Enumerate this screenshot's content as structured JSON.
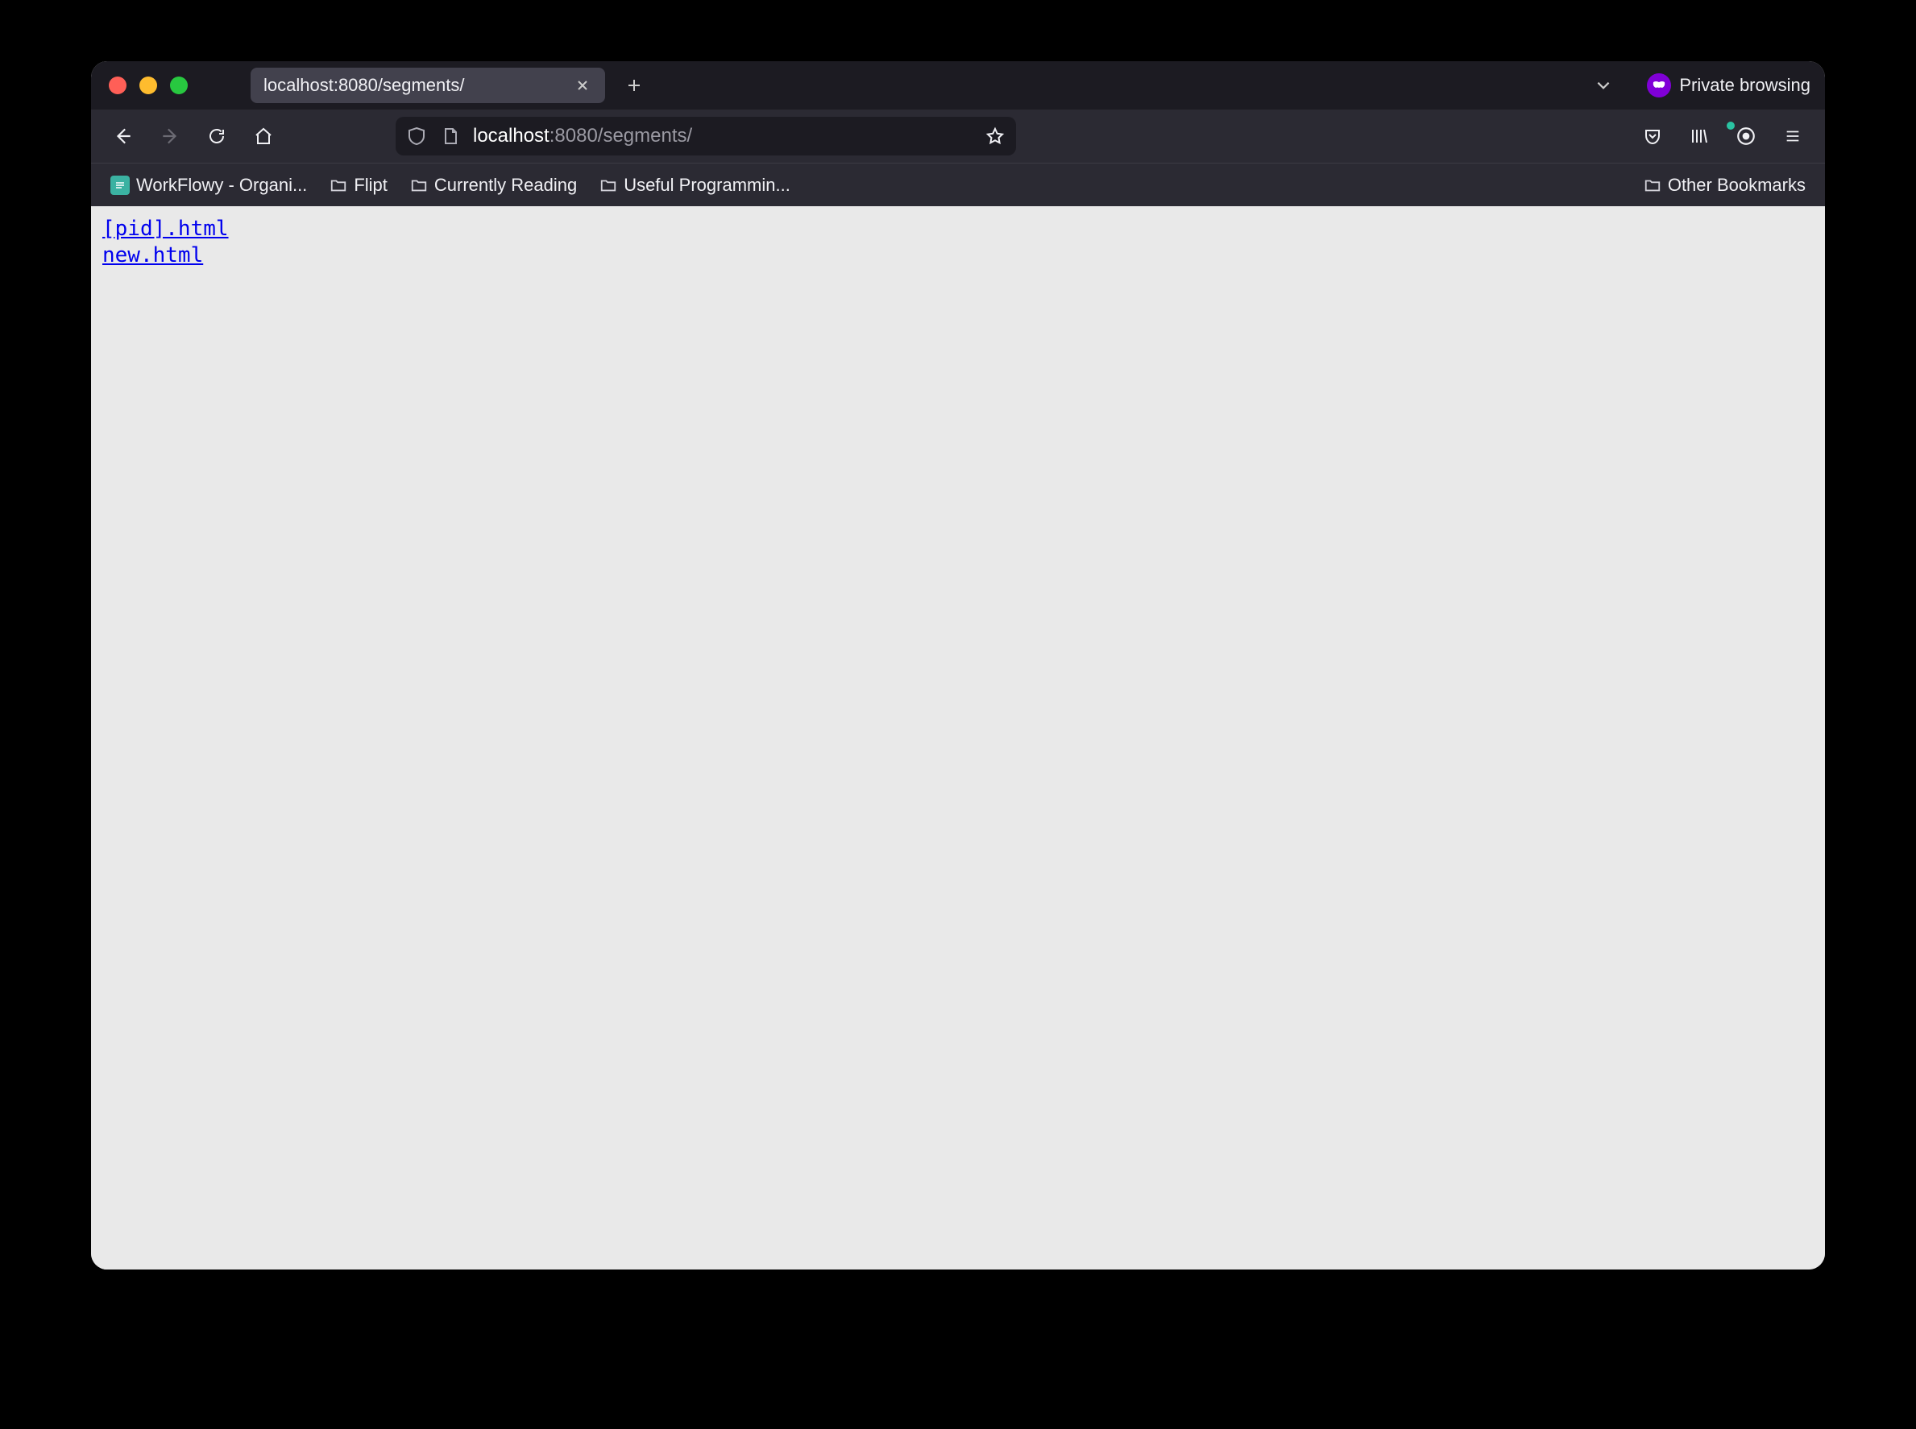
{
  "tab": {
    "title": "localhost:8080/segments/"
  },
  "private_label": "Private browsing",
  "address": {
    "host": "localhost",
    "path": ":8080/segments/"
  },
  "bookmarks": {
    "items": [
      {
        "label": "WorkFlowy - Organi...",
        "kind": "site"
      },
      {
        "label": "Flipt",
        "kind": "folder"
      },
      {
        "label": "Currently Reading",
        "kind": "folder"
      },
      {
        "label": "Useful Programmin...",
        "kind": "folder"
      }
    ],
    "other_label": "Other Bookmarks"
  },
  "page": {
    "links": [
      "[pid].html",
      "new.html"
    ]
  }
}
